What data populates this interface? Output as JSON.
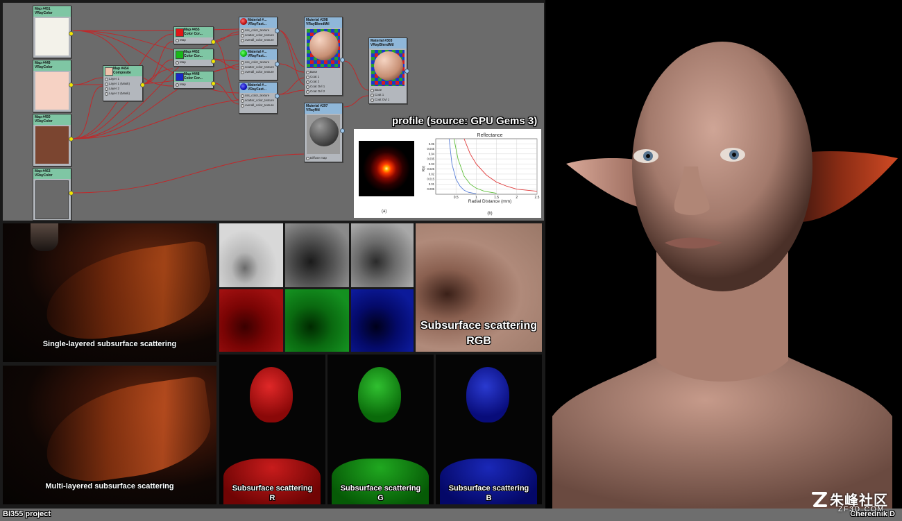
{
  "nodes": {
    "n451": {
      "title": "Map #451",
      "type": "VRayColor",
      "swatch": "#f3f2ea"
    },
    "n449": {
      "title": "Map #449",
      "type": "VRayColor",
      "swatch": "#f6d2c4"
    },
    "n450": {
      "title": "Map #450",
      "type": "VRayColor",
      "swatch": "#7b4530"
    },
    "n463": {
      "title": "Map #463",
      "type": "VRayColor",
      "swatch": "#6a6a6a"
    },
    "n454": {
      "title": "Map #454",
      "type": "Composite",
      "swatch": "#f0c2aa",
      "slots": [
        "Layer 1",
        "Layer 1 (Mask)",
        "Layer 2",
        "Layer 2 (Mask)"
      ]
    },
    "n455": {
      "title": "Map #455",
      "type": "Color Cor...",
      "swatch": "#e01818",
      "slot": "Map"
    },
    "n452": {
      "title": "Map #452",
      "type": "Color Cor...",
      "swatch": "#18b818",
      "slot": "Map"
    },
    "n448": {
      "title": "Map #448",
      "type": "Color Cor...",
      "swatch": "#1828c8",
      "slot": "Map"
    },
    "mA": {
      "title": "Material #...",
      "type": "VRayFast...",
      "slots": [
        "sss_color_texture",
        "scatter_color_texture",
        "overall_color_texture"
      ]
    },
    "mB": {
      "title": "Material #...",
      "type": "VRayFast...",
      "slots": [
        "sss_color_texture",
        "scatter_color_texture",
        "overall_color_texture"
      ]
    },
    "mC": {
      "title": "Material #...",
      "type": "VRayFast...",
      "slots": [
        "sss_color_texture",
        "scatter_color_texture",
        "overall_color_texture"
      ]
    },
    "m298": {
      "title": "Material #298",
      "type": "VRayBlendMtl",
      "slots": [
        "Base",
        "Coat 1",
        "Coat 2",
        "Coat Ovl 1",
        "Coat Ovl 2"
      ]
    },
    "m297": {
      "title": "Material #297",
      "type": "VRayMtl",
      "slots": [
        "Diffuse map"
      ]
    },
    "m303": {
      "title": "Material #303",
      "type": "VRayBlendMtl",
      "slots": [
        "Base",
        "Coat 1",
        "Coat Ovl 1"
      ]
    }
  },
  "profile": {
    "title": "profile (source: GPU Gems 3)",
    "label_a": "(a)",
    "label_b": "(b)"
  },
  "chart_data": {
    "type": "line",
    "title": "Reflectance",
    "xlabel": "Radial Distance (mm)",
    "ylabel": "R(r)",
    "xlim": [
      0,
      2.5
    ],
    "ylim": [
      0,
      0.055
    ],
    "x_ticks": [
      "0.5",
      "1",
      "1.5",
      "2",
      "2.5"
    ],
    "y_ticks": [
      "0.005",
      "0.01",
      "0.015",
      "0.02",
      "0.025",
      "0.03",
      "0.035",
      "0.04",
      "0.045",
      "0.05"
    ],
    "grid": true,
    "series": [
      {
        "color": "#5a7fd8",
        "x": [
          0.33,
          0.4,
          0.5,
          0.6,
          0.7,
          0.8,
          1.0
        ],
        "y": [
          0.055,
          0.03,
          0.015,
          0.008,
          0.004,
          0.002,
          0.0005
        ]
      },
      {
        "color": "#5fbf3a",
        "x": [
          0.45,
          0.55,
          0.7,
          0.85,
          1.0,
          1.2,
          1.5
        ],
        "y": [
          0.055,
          0.035,
          0.018,
          0.01,
          0.006,
          0.003,
          0.001
        ]
      },
      {
        "color": "#e03a3a",
        "x": [
          0.7,
          0.85,
          1.0,
          1.25,
          1.5,
          1.75,
          2.0,
          2.25,
          2.5
        ],
        "y": [
          0.055,
          0.04,
          0.03,
          0.019,
          0.012,
          0.008,
          0.005,
          0.004,
          0.003
        ]
      }
    ]
  },
  "captions": {
    "single": "Single-layered subsurface scattering",
    "multi": "Multi-layered subsurface scattering",
    "rgb_line1": "Subsurface scattering",
    "rgb_line2": "RGB",
    "r_line1": "Subsurface scattering",
    "r_line2": "R",
    "g_line1": "Subsurface scattering",
    "g_line2": "G",
    "b_line1": "Subsurface scattering",
    "b_line2": "B"
  },
  "footer": {
    "project": "BI355 project",
    "author": "Cherednik D",
    "watermark_cn": "朱峰社区",
    "watermark_url": "ZF3D.COM"
  }
}
